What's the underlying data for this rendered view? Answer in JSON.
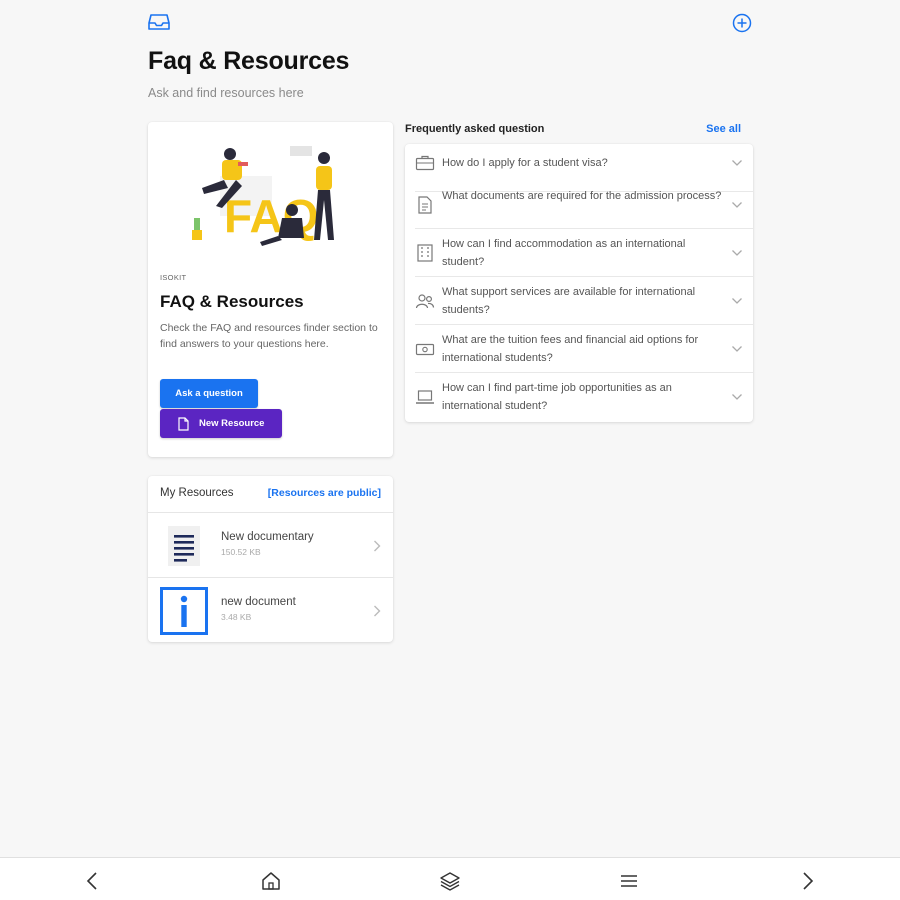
{
  "header": {
    "title": "Faq & Resources",
    "subtitle": "Ask and find resources here",
    "icons": [
      "inbox-icon",
      "add-circle-icon"
    ]
  },
  "promo": {
    "brand": "ISOKIT",
    "title": "FAQ & Resources",
    "description": "Check the FAQ and resources finder section to find answers to your questions here.",
    "ask_label": "Ask a question",
    "new_label": "New Resource"
  },
  "resources": {
    "title": "My Resources",
    "public_label": "[Resources are public]",
    "items": [
      {
        "name": "New documentary",
        "size": "150.52 KB",
        "icon": "document-lines-icon"
      },
      {
        "name": "new document",
        "size": "3.48 KB",
        "icon": "info-icon"
      }
    ]
  },
  "faq": {
    "title": "Frequently asked question",
    "see_all": "See all",
    "items": [
      {
        "q": "How do I apply for a student visa?",
        "icon": "briefcase-icon"
      },
      {
        "q": "What documents are required for the admission process?",
        "icon": "document-icon"
      },
      {
        "q": "How can I find accommodation as an international student?",
        "icon": "building-icon"
      },
      {
        "q": "What support services are available for international students?",
        "icon": "people-icon"
      },
      {
        "q": "What are the tuition fees and financial aid options for international students?",
        "icon": "money-icon"
      },
      {
        "q": "How can I find part-time job opportunities as an international student?",
        "icon": "laptop-icon"
      }
    ]
  },
  "colors": {
    "primary_blue": "#1a73f0",
    "purple": "#5b25c2",
    "accent_yellow": "#f5c518"
  }
}
